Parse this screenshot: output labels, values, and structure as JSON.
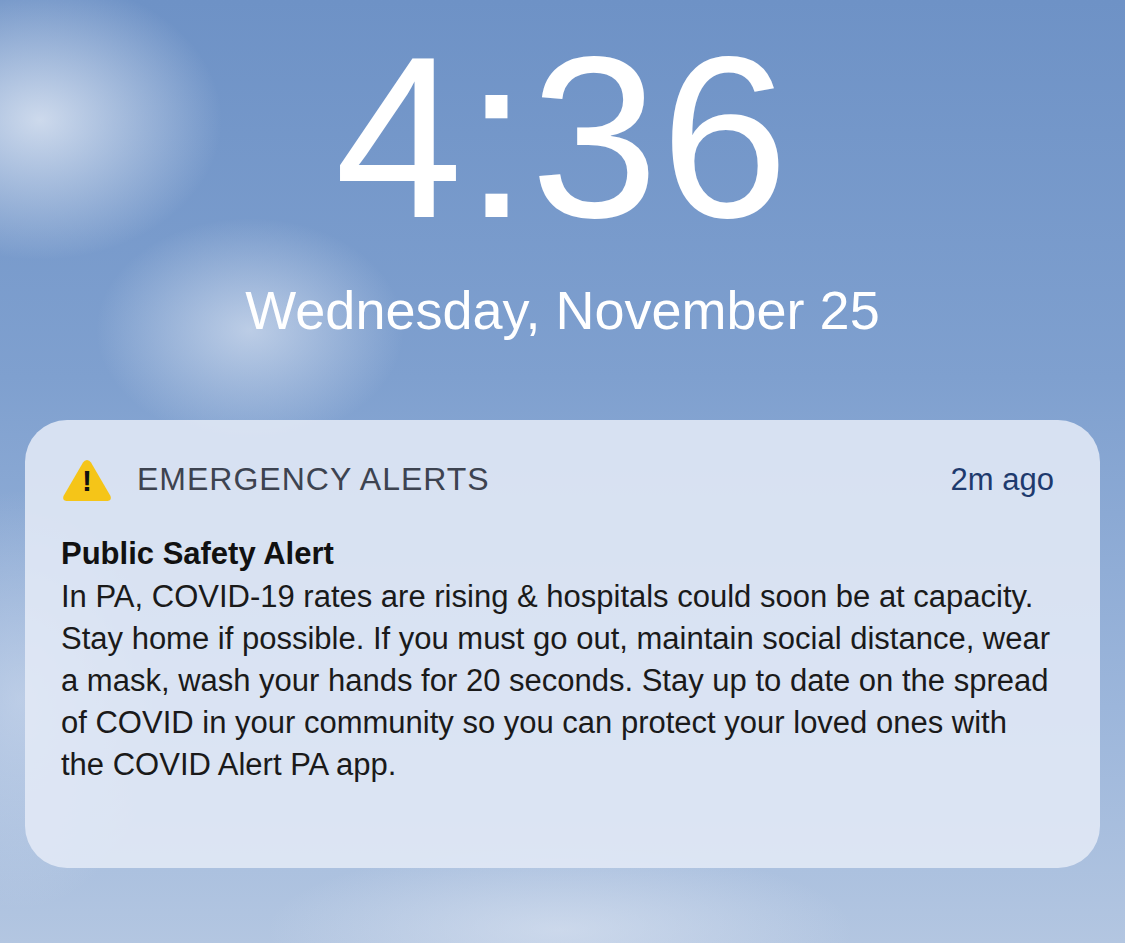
{
  "lock_screen": {
    "time": "4:36",
    "date": "Wednesday, November 25"
  },
  "notification": {
    "icon": "!",
    "app": "EMERGENCY ALERTS",
    "age": "2m ago",
    "title": "Public Safety Alert",
    "body": "In PA, COVID-19 rates are rising & hospitals could soon be at capacity. Stay home if possible. If you must go out, maintain social distance, wear a mask, wash your hands for 20 seconds. Stay up to date on the spread of COVID in your community so you can protect your loved ones with the COVID Alert PA app."
  }
}
